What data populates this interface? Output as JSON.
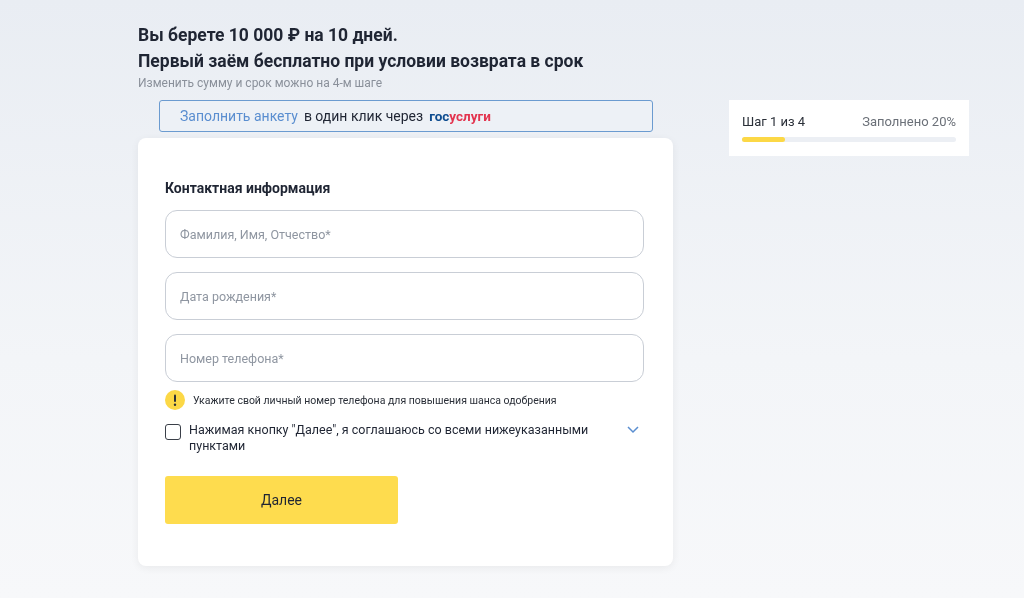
{
  "header": {
    "title_line_1": "Вы берете 10 000 ₽ на 10 дней.",
    "title_line_2": "Первый заём бесплатно при условии возврата в срок",
    "subtitle": "Изменить сумму и срок можно на 4-м шаге"
  },
  "gosuslugi_banner": {
    "link": "Заполнить анкету",
    "text": "в один клик через",
    "logo_part_1": "гос",
    "logo_part_2": "услуги"
  },
  "form": {
    "section_title": "Контактная информация",
    "fields": [
      {
        "placeholder": "Фамилия, Имя, Отчество*"
      },
      {
        "placeholder": "Дата рождения*"
      },
      {
        "placeholder": "Номер телефона*"
      }
    ],
    "hint": "Укажите свой личный номер телефона для повышения шанса одобрения",
    "consent": {
      "label": "Нажимая кнопку \"Далее\", я соглашаюсь со всеми нижеуказанными пунктами",
      "checked": false,
      "expanded": false
    },
    "submit": "Далее"
  },
  "progress": {
    "step": "Шаг 1 из 4",
    "filled": "Заполнено 20%",
    "level": 0.2
  }
}
